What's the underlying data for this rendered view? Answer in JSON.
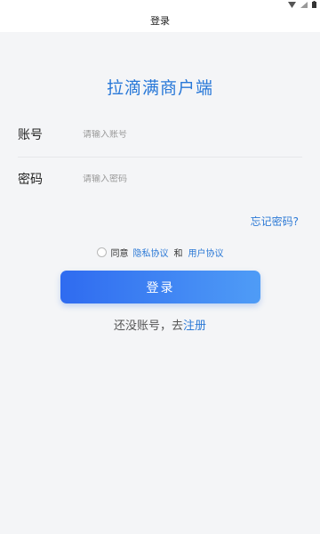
{
  "header": {
    "title": "登录"
  },
  "status_icons": [
    "wifi-icon",
    "signal-icon",
    "battery-icon"
  ],
  "app": {
    "name": "拉滴满商户端"
  },
  "form": {
    "account_label": "账号",
    "account_placeholder": "请输入账号",
    "account_value": "",
    "password_label": "密码",
    "password_placeholder": "请输入密码",
    "password_value": ""
  },
  "forgot_password": "忘记密码?",
  "agreement": {
    "checked": false,
    "prefix": "同意",
    "privacy_link": "隐私协议",
    "conjunction": "和",
    "user_link": "用户协议"
  },
  "login_button": "登录",
  "register": {
    "prompt": "还没账号，去",
    "link": "注册"
  },
  "colors": {
    "accent": "#2d7ad6",
    "title": "#2878d8",
    "button_start": "#2f6bf0",
    "button_end": "#4f9cf6",
    "background": "#f4f5f7"
  }
}
